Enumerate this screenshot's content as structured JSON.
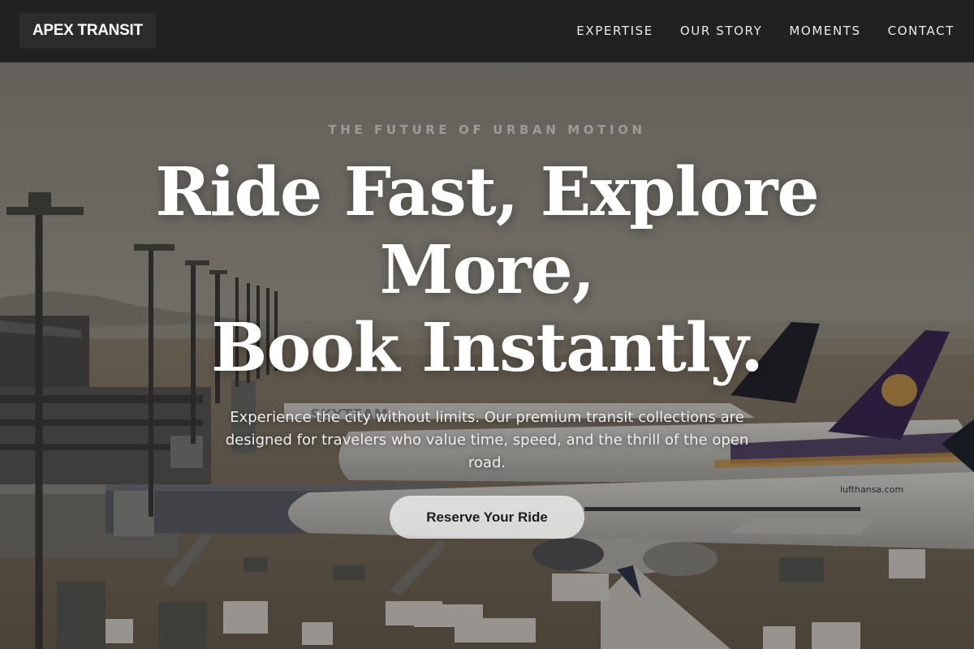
{
  "brand": {
    "logo_text": "APEX TRANSIT"
  },
  "nav": {
    "items": [
      {
        "label": "EXPERTISE"
      },
      {
        "label": "OUR STORY"
      },
      {
        "label": "MOMENTS"
      },
      {
        "label": "CONTACT"
      }
    ]
  },
  "hero": {
    "eyebrow": "THE FUTURE OF URBAN MOTION",
    "headline_lines": [
      "Ride Fast, Explore",
      "More,",
      "Book Instantly."
    ],
    "subtext": "Experience the city without limits. Our premium transit collections are designed for travelers who value time, speed, and the thrill of the open road.",
    "cta_label": "Reserve Your Ride",
    "background_image": {
      "airline_text_1": "SKYTEAM",
      "airline_text_2": "lufthansa.com"
    }
  },
  "colors": {
    "header_bg": "#212121",
    "logo_bg": "#2c2c2c",
    "cta_bg": "#eeeeee",
    "cta_text": "#1d1d1d"
  }
}
